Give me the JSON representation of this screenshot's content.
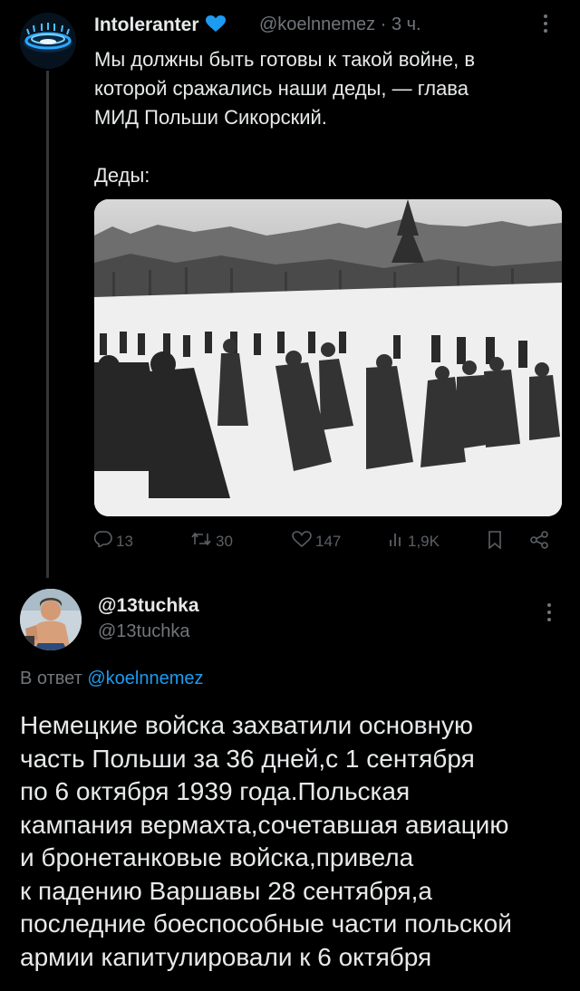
{
  "tweet": {
    "author_name": "Intoleranter",
    "author_handle": "@koelnnemez",
    "time": "3 ч.",
    "text": "Мы должны быть готовы к такой войне, в\nкоторой сражались наши деды, — глава\nМИД Польши Сикорский.\n\nДеды:",
    "actions": {
      "replies": "13",
      "retweets": "30",
      "likes": "147",
      "views": "1,9K"
    }
  },
  "reply": {
    "author_name": "@13tuchka",
    "author_handle": "@13tuchka",
    "replying_prefix": "В ответ",
    "replying_to": "@koelnnemez",
    "text": "Немецкие войска захватили основную\nчасть Польши за 36 дней,с 1 сентября\nпо 6 октября 1939 года.Польская\nкампания вермахта,сочетавшая авиацию\nи бронетанковые войска,привела\nк падению Варшавы 28 сентября,а\nпоследние боеспособные части польской\nармии капитулировали к 6 октября"
  },
  "colors": {
    "background": "#000000",
    "text": "#e7e9ea",
    "muted": "#71767b",
    "link": "#1d9bf0",
    "verified_heart": "#1d9bf0"
  }
}
